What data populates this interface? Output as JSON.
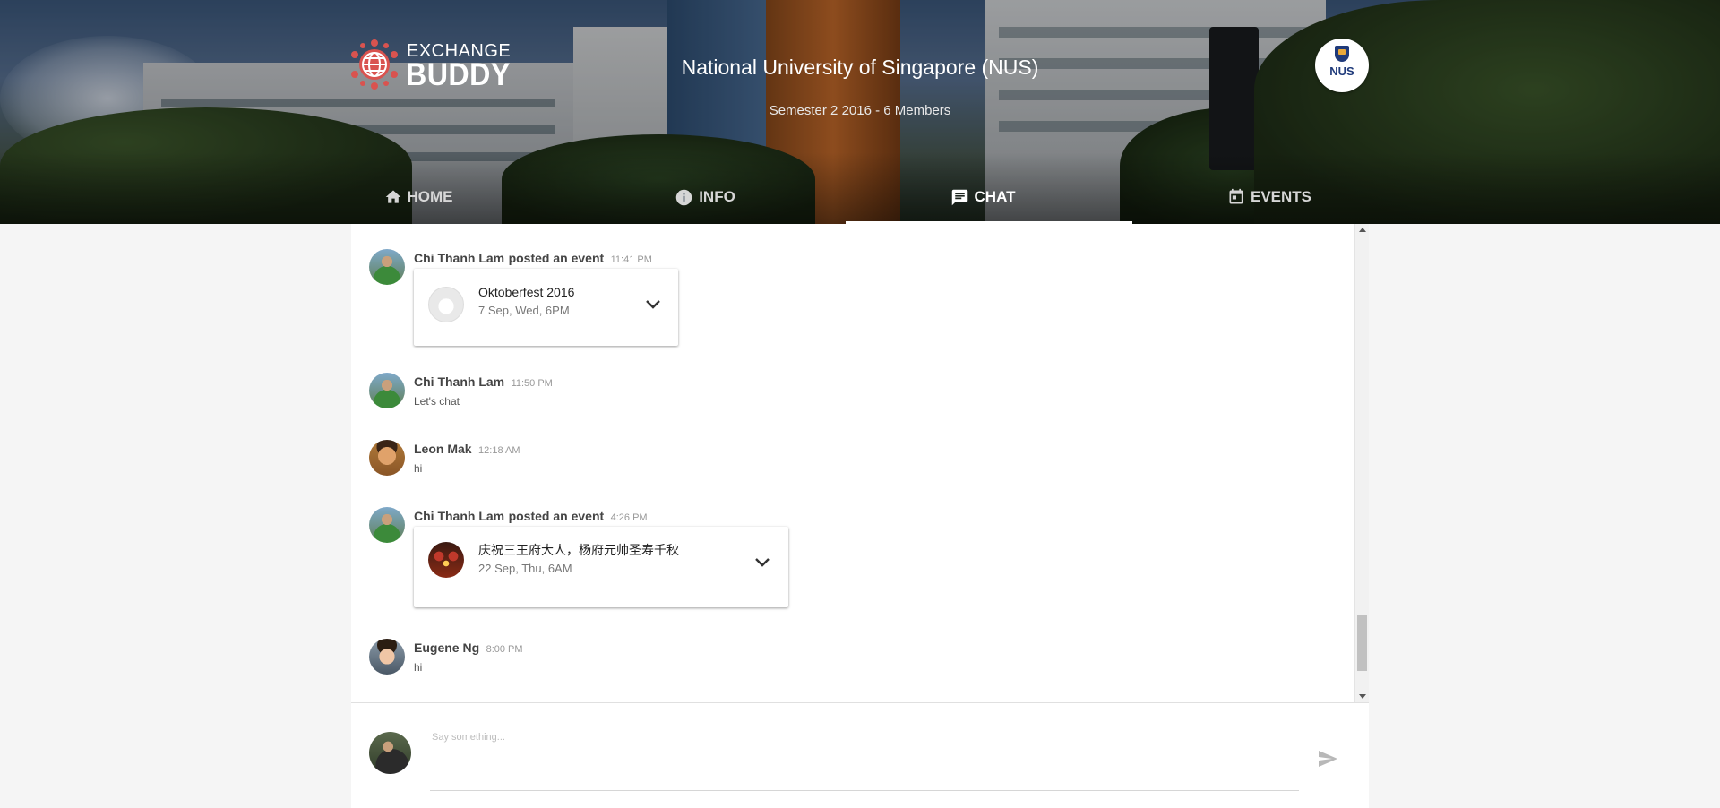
{
  "header": {
    "logo": {
      "line1": "EXCHANGE",
      "line2": "BUDDY"
    },
    "title": "National University of Singapore (NUS)",
    "subtitle": "Semester 2 2016 - 6 Members",
    "badge": {
      "text": "NUS"
    }
  },
  "nav": {
    "tabs": [
      {
        "label": "HOME",
        "icon": "home-icon"
      },
      {
        "label": "INFO",
        "icon": "info-icon"
      },
      {
        "label": "CHAT",
        "icon": "chat-icon",
        "active": true
      },
      {
        "label": "EVENTS",
        "icon": "calendar-icon"
      }
    ]
  },
  "messages": [
    {
      "author": "Chi Thanh Lam",
      "action": "posted an event",
      "time": "11:41 PM",
      "event": {
        "title": "Oktoberfest 2016",
        "date": "7 Sep, Wed, 6PM"
      }
    },
    {
      "author": "Chi Thanh Lam",
      "time": "11:50 PM",
      "text": "Let's chat"
    },
    {
      "author": "Leon Mak",
      "time": "12:18 AM",
      "text": "hi"
    },
    {
      "author": "Chi Thanh Lam",
      "action": "posted an event",
      "time": "4:26 PM",
      "event": {
        "title": "庆祝三王府大人，杨府元帅圣寿千秋",
        "date": "22 Sep, Thu, 6AM"
      }
    },
    {
      "author": "Eugene Ng",
      "time": "8:00 PM",
      "text": "hi"
    }
  ],
  "composer": {
    "placeholder": "Say something...",
    "value": ""
  },
  "colors": {
    "accent": "#ffffff",
    "logo_red": "#d9534f"
  }
}
